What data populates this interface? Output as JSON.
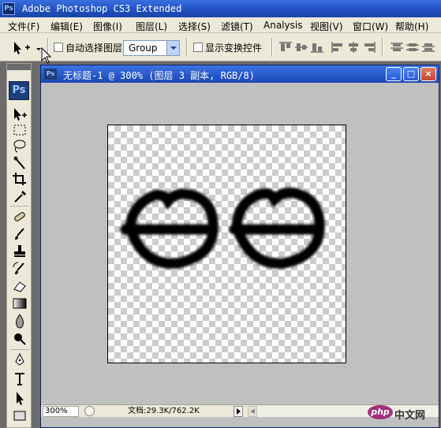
{
  "app": {
    "title": "Adobe Photoshop CS3 Extended",
    "icon_text": "Ps"
  },
  "menu": [
    "文件(F)",
    "编辑(E)",
    "图像(I)",
    "图层(L)",
    "选择(S)",
    "滤镜(T)",
    "Analysis",
    "视图(V)",
    "窗口(W)",
    "帮助(H)"
  ],
  "options": {
    "auto_select_label": "自动选择图层",
    "auto_select_checked": false,
    "group_select": "Group",
    "transform_label": "显示变换控件",
    "transform_checked": false
  },
  "toolbox": {
    "logo": "Ps"
  },
  "document": {
    "title": "无标题-1 @ 300% (图层 3 副本, RGB/8)",
    "icon_text": "Ps",
    "window_buttons": [
      "_",
      "□",
      "×"
    ],
    "zoom": "300%",
    "doc_size": "文档:29.3K/762.2K"
  },
  "watermark": {
    "logo": "php",
    "text": "中文网"
  },
  "colors": {
    "titlebar": "#2556c9",
    "chrome": "#ece9d8",
    "workspace": "#c0c0c0",
    "watermark": "#a12f7a"
  }
}
